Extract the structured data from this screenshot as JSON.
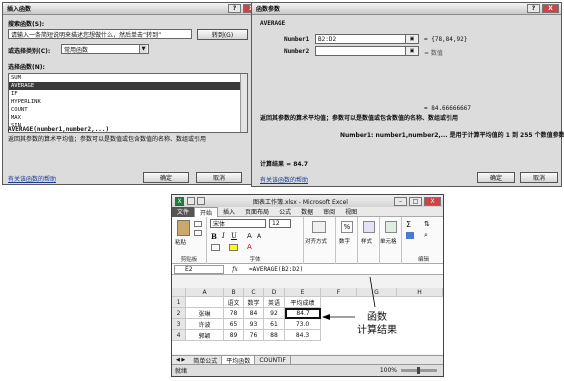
{
  "insert_dialog": {
    "title": "插入函数",
    "search_label": "搜索函数(S):",
    "search_value": "请输入一条简短说明来描述您想做什么，然后单击“转到”",
    "go_button": "转到(G)",
    "category_label": "或选择类别(C):",
    "category_value": "常用函数",
    "select_label": "选择函数(N):",
    "functions": [
      "SUM",
      "AVERAGE",
      "IF",
      "HYPERLINK",
      "COUNT",
      "MAX",
      "SIN"
    ],
    "selected_index": 1,
    "signature": "AVERAGE(number1,number2,...)",
    "description": "返回其参数的算术平均值；参数可以是数值或包含数值的名称、数组或引用",
    "help_link": "有关该函数的帮助",
    "ok": "确定",
    "cancel": "取消",
    "help_btn": "?",
    "close_btn": "X"
  },
  "args_dialog": {
    "title": "函数参数",
    "func_name": "AVERAGE",
    "number1_label": "Number1",
    "number1_value": "B2:D2",
    "number1_result": "= {78,84,92}",
    "number2_label": "Number2",
    "number2_result": "= 数值",
    "total_result": "= 84.66666667",
    "description": "返回其参数的算术平均值；参数可以是数值或包含数值的名称、数组或引用",
    "param_desc": "Number1:  number1,number2,...  是用于计算平均值的 1 到 255 个数值参数",
    "calc_result": "计算结果 = 84.7",
    "help_link": "有关该函数的帮助",
    "ok": "确定",
    "cancel": "取消",
    "help_btn": "?",
    "close_btn": "X"
  },
  "excel": {
    "title": "图表工作簿.xlsx - Microsoft Excel",
    "tabs": [
      "文件",
      "开始",
      "插入",
      "页面布局",
      "公式",
      "数据",
      "审阅",
      "视图"
    ],
    "font_name": "宋体",
    "font_size": "12",
    "groups": {
      "clipboard": "剪贴板",
      "font": "字体",
      "editing": "编辑",
      "paste": "粘贴",
      "align": "对齐方式",
      "number": "数字",
      "styles": "样式",
      "cells": "单元格"
    },
    "name_box": "E2",
    "fx": "fx",
    "formula": "=AVERAGE(B2:D2)",
    "columns": [
      "A",
      "B",
      "C",
      "D",
      "E",
      "F",
      "G",
      "H"
    ],
    "rows": [
      [
        "",
        "语文",
        "数学",
        "英语",
        "平均成绩"
      ],
      [
        "张琳",
        "78",
        "84",
        "92",
        "84.7"
      ],
      [
        "许波",
        "65",
        "93",
        "61",
        "73.0"
      ],
      [
        "郭颖",
        "89",
        "76",
        "88",
        "84.3"
      ]
    ],
    "row_numbers": [
      "1",
      "2",
      "3",
      "4"
    ],
    "sheet_tabs": [
      "简单公式",
      "平均函数",
      "COUNTIF"
    ],
    "active_sheet": 1,
    "status": "就绪",
    "zoom": "100%",
    "annotation_func": "函数",
    "annotation_result": "计算结果"
  }
}
